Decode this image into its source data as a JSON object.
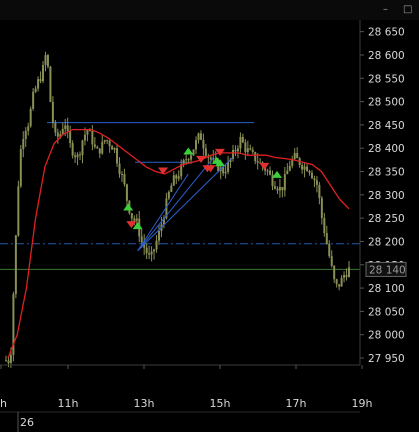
{
  "window": {
    "minimize_glyph": "–",
    "close_glyph": "□"
  },
  "colors": {
    "background": "#000000",
    "candle": "#8a8f55",
    "ma_line": "#e02020",
    "trendline": "#2c5fd0",
    "hline_solid": "#2c5fd0",
    "hline_dashdot": "#1e5aa8",
    "current_price_line": "#3a7a30",
    "up_arrow": "#3ccf3c",
    "down_arrow": "#e03030",
    "axis_text": "#d8d8d8"
  },
  "chart_data": {
    "type": "candlestick",
    "title": "",
    "xlabel": "",
    "ylabel": "",
    "ylim": [
      27935,
      28675
    ],
    "y_ticks": [
      "28 650",
      "28 600",
      "28 550",
      "28 500",
      "28 450",
      "28 400",
      "28 350",
      "28 300",
      "28 250",
      "28 200",
      "28 150",
      "28 100",
      "28 050",
      "28 000",
      "27 950"
    ],
    "x_ticks": [
      "h",
      "11h",
      "13h",
      "15h",
      "17h",
      "19h"
    ],
    "date_labels": [
      "26"
    ],
    "current_price": 28140,
    "current_price_label": "28 140",
    "resistance_level": 28455,
    "dashdot_level": 28195,
    "candle_path": [
      27945,
      27945,
      28170,
      28380,
      28440,
      28455,
      28510,
      28540,
      28560,
      28610,
      28480,
      28420,
      28430,
      28460,
      28410,
      28390,
      28380,
      28420,
      28440,
      28420,
      28390,
      28400,
      28420,
      28410,
      28400,
      28360,
      28330,
      28280,
      28250,
      28240,
      28200,
      28180,
      28160,
      28190,
      28220,
      28260,
      28300,
      28330,
      28340,
      28360,
      28380,
      28390,
      28410,
      28430,
      28400,
      28380,
      28370,
      28360,
      28350,
      28360,
      28380,
      28400,
      28420,
      28400,
      28390,
      28380,
      28370,
      28360,
      28350,
      28330,
      28320,
      28310,
      28340,
      28370,
      28380,
      28370,
      28360,
      28360,
      28340,
      28320,
      28250,
      28200,
      28150,
      28100,
      28110,
      28130,
      28140
    ],
    "ma_path": [
      27950,
      28000,
      28100,
      28250,
      28360,
      28410,
      28430,
      28440,
      28440,
      28440,
      28432,
      28420,
      28405,
      28390,
      28375,
      28360,
      28350,
      28345,
      28355,
      28365,
      28370,
      28375,
      28385,
      28390,
      28390,
      28390,
      28385,
      28385,
      28385,
      28380,
      28378,
      28375,
      28370,
      28365,
      28350,
      28320,
      28290,
      28270
    ],
    "trendlines": [
      {
        "x": [
          "12:50",
          "14:10"
        ],
        "y": [
          28180,
          28345
        ]
      },
      {
        "x": [
          "12:50",
          "14:50"
        ],
        "y": [
          28180,
          28380
        ]
      },
      {
        "x": [
          "12:50",
          "15:20"
        ],
        "y": [
          28180,
          28380
        ]
      }
    ],
    "signals": [
      {
        "x": "12:35",
        "y": 28275,
        "direction": "up"
      },
      {
        "x": "12:40",
        "y": 28235,
        "direction": "down"
      },
      {
        "x": "12:50",
        "y": 28235,
        "direction": "up"
      },
      {
        "x": "13:30",
        "y": 28350,
        "direction": "down"
      },
      {
        "x": "14:10",
        "y": 28395,
        "direction": "up"
      },
      {
        "x": "14:30",
        "y": 28375,
        "direction": "down"
      },
      {
        "x": "14:40",
        "y": 28355,
        "direction": "down"
      },
      {
        "x": "14:45",
        "y": 28355,
        "direction": "down"
      },
      {
        "x": "14:55",
        "y": 28375,
        "direction": "up"
      },
      {
        "x": "15:00",
        "y": 28390,
        "direction": "down"
      },
      {
        "x": "15:00",
        "y": 28370,
        "direction": "up"
      },
      {
        "x": "16:10",
        "y": 28360,
        "direction": "down"
      },
      {
        "x": "16:30",
        "y": 28345,
        "direction": "up"
      }
    ]
  }
}
